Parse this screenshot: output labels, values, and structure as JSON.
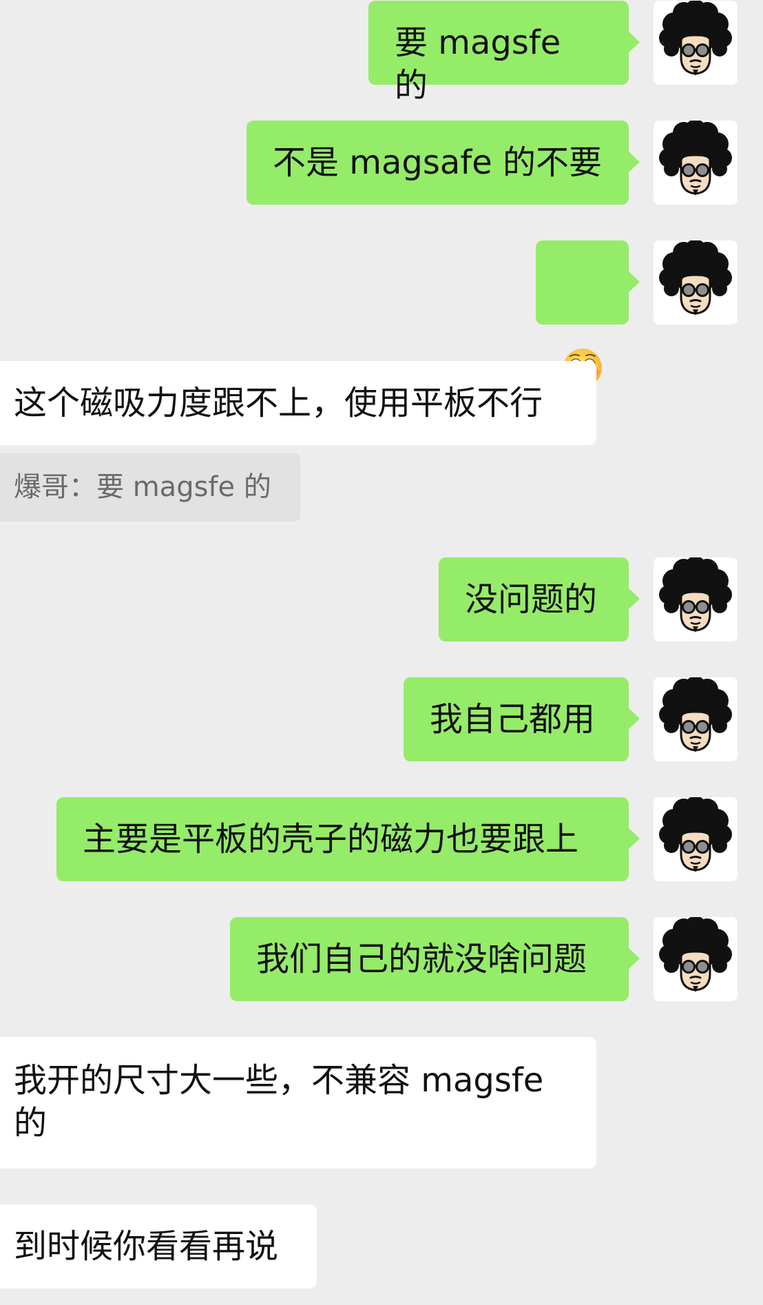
{
  "quoted_message": {
    "sender": "爆哥",
    "separator": "：",
    "text": "要 magsfe 的"
  },
  "messages": [
    {
      "direction": "outgoing",
      "text": "要 magsfe 的"
    },
    {
      "direction": "outgoing",
      "text": "不是 magsafe 的不要"
    },
    {
      "direction": "outgoing",
      "emoji": "flushed-face-icon"
    },
    {
      "direction": "incoming",
      "text": "这个磁吸力度跟不上，使用平板不行"
    },
    {
      "direction": "outgoing",
      "text": "没问题的"
    },
    {
      "direction": "outgoing",
      "text": "我自己都用"
    },
    {
      "direction": "outgoing",
      "text": "主要是平板的壳子的磁力也要跟上"
    },
    {
      "direction": "outgoing",
      "text": "我们自己的就没啥问题"
    },
    {
      "direction": "incoming",
      "text": "我开的尺寸大一些，不兼容 magsfe 的"
    },
    {
      "direction": "incoming",
      "text": "到时候你看看再说"
    }
  ],
  "colors": {
    "background": "#EDEDED",
    "outgoing_bubble": "#95EC69",
    "incoming_bubble": "#FFFFFF",
    "quote_background": "#E2E2E2",
    "quote_text": "#6A6A6A"
  }
}
